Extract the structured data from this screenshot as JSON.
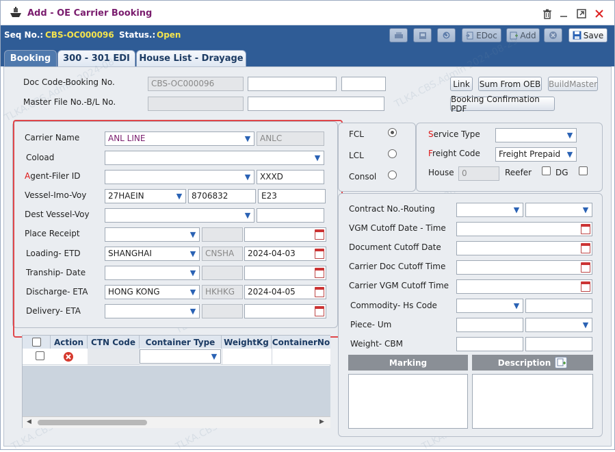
{
  "window": {
    "title": "Add - OE Carrier Booking",
    "controls": [
      "trash-icon",
      "minimize-icon",
      "restore-icon",
      "close-icon"
    ]
  },
  "status_bar": {
    "seq_label": "Seq No.:",
    "seq_value": "CBS-OC000096",
    "status_label": "Status.:",
    "status_value": "Open",
    "buttons": {
      "edoc": "EDoc",
      "add": "Add",
      "save": "Save"
    }
  },
  "tabs": [
    "Booking",
    "300 - 301 EDI",
    "House List - Drayage"
  ],
  "header": {
    "doc_code_label": "Doc Code-Booking No.",
    "doc_code_value": "CBS-OC000096",
    "master_label": "Master File No.-B/L No.",
    "link_button": "Link",
    "sum_button": "Sum From OEB",
    "buildmaster_button": "BuildMaster",
    "confirm_pdf_button": "Booking Confirmation PDF"
  },
  "left_form": {
    "carrier_name_label": "Carrier Name",
    "carrier_name_value": "ANL LINE",
    "carrier_code": "ANLC",
    "coload_label": "Coload",
    "agent_filer_label_first": "A",
    "agent_filer_label_rest": "gent-Filer ID",
    "agent_filer_code": "XXXD",
    "vessel_label": "Vessel-Imo-Voy",
    "vessel_value": "27HAEIN",
    "imo_value": "8706832",
    "voyage_value": "E23",
    "dest_vessel_label": "Dest Vessel-Voy",
    "place_receipt_label": "Place Receipt",
    "loading_label": "Loading- ETD",
    "loading_value": "SHANGHAI",
    "loading_code": "CNSHA",
    "loading_date": "2024-04-03",
    "tranship_label": "Tranship- Date",
    "discharge_label": "Discharge- ETA",
    "discharge_value": "HONG KONG",
    "discharge_code": "HKHKG",
    "discharge_date": "2024-04-05",
    "delivery_label": "Delivery- ETA"
  },
  "load_type": {
    "fcl": "FCL",
    "lcl": "LCL",
    "consol": "Consol",
    "selected": "FCL"
  },
  "service": {
    "service_type_label_first": "S",
    "service_type_label_rest": "ervice Type",
    "freight_code_label_first": "F",
    "freight_code_label_rest": "reight Code",
    "freight_code_value": "Freight Prepaid",
    "house_label": "House",
    "house_value": "0",
    "reefer_label": "Reefer",
    "dg_label": "DG"
  },
  "right_form": {
    "contract_label": "Contract No.-Routing",
    "vgm_cutoff_label": "VGM Cutoff Date - Time",
    "doc_cutoff_label": "Document Cutoff Date",
    "carrier_doc_cutoff_label": "Carrier Doc Cutoff Time",
    "carrier_vgm_cutoff_label": "Carrier VGM Cutoff Time",
    "commodity_label": "Commodity- Hs Code",
    "piece_label": "Piece- Um",
    "weight_label": "Weight- CBM",
    "marking_header": "Marking",
    "description_header": "Description"
  },
  "container_grid": {
    "columns": [
      "Action",
      "CTN Code",
      "Container Type",
      "WeightKg",
      "ContainerNo"
    ]
  },
  "watermark": "TLKA.CBS.Admin 2024-08-29",
  "colors": {
    "title": "#7a1d6e",
    "bar": "#2f5c96",
    "seq_value": "#f4e44d",
    "required": "#dd1111",
    "highlight_box": "#e0464a"
  }
}
